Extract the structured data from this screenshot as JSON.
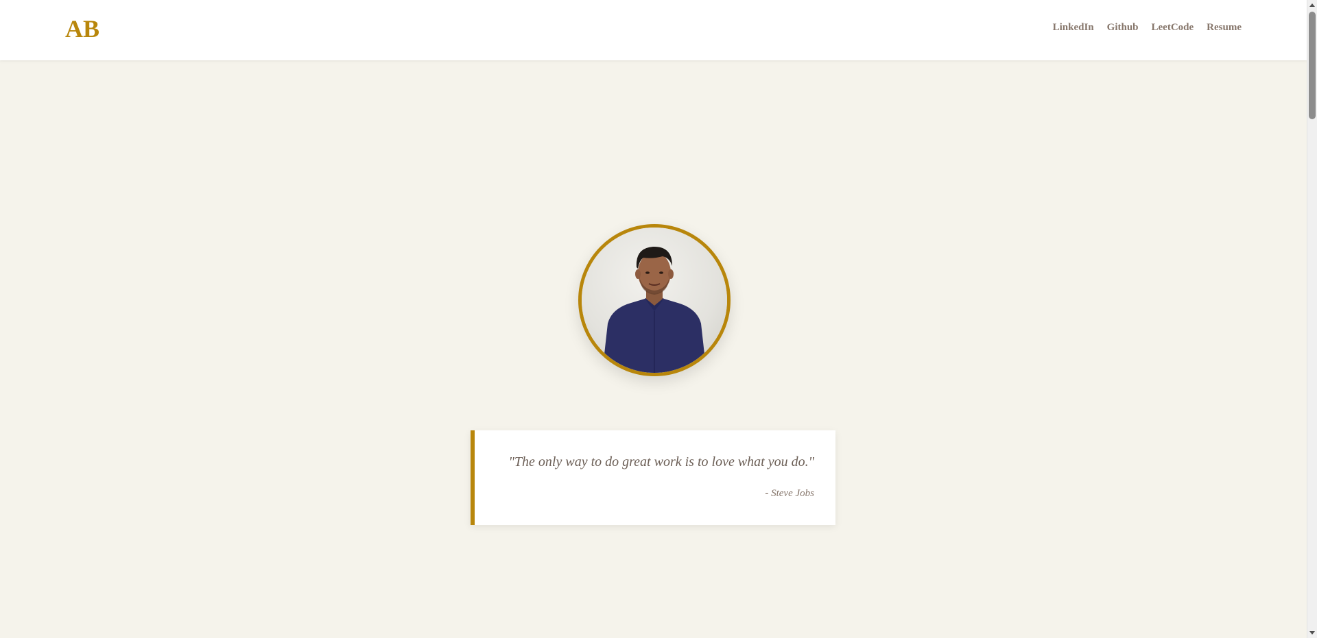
{
  "header": {
    "logo": "AB",
    "nav": [
      {
        "label": "LinkedIn"
      },
      {
        "label": "Github"
      },
      {
        "label": "LeetCode"
      },
      {
        "label": "Resume"
      }
    ]
  },
  "hero": {
    "quote": "\"The only way to do great work is to love what you do.\"",
    "author": "- Steve Jobs"
  },
  "colors": {
    "accent": "#b8860b",
    "background": "#f5f3eb",
    "nav_text": "#86766b"
  }
}
